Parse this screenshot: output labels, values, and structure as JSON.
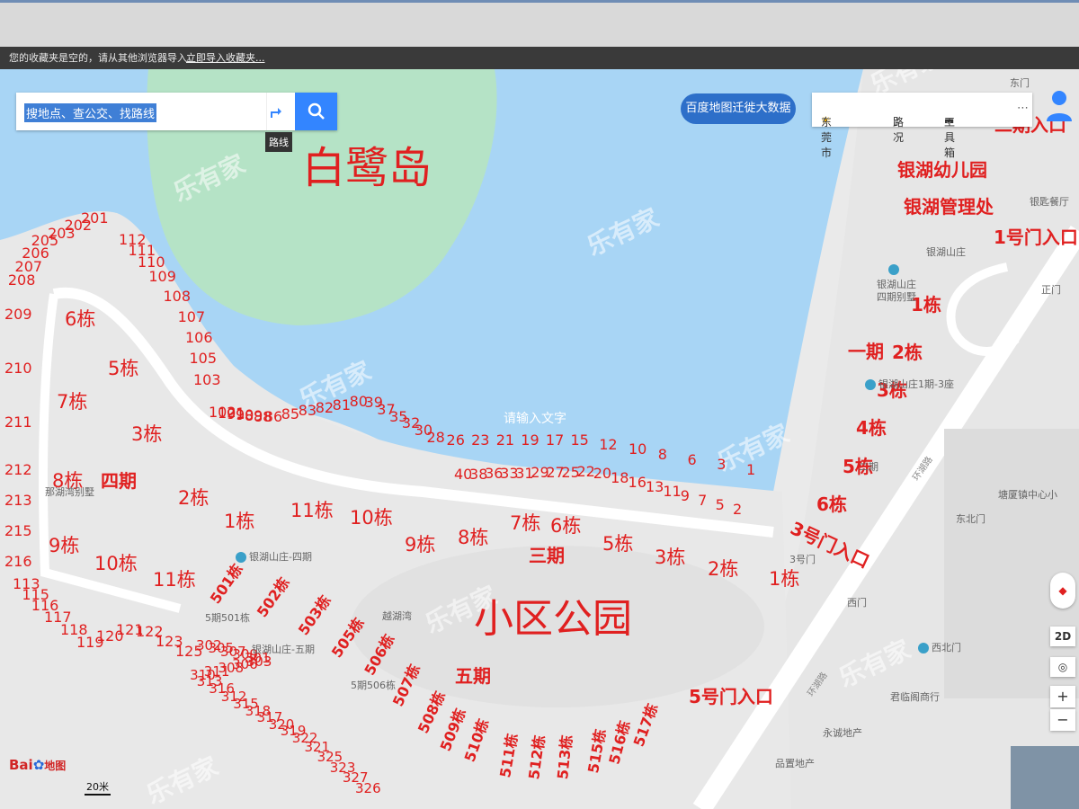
{
  "favorites_bar": {
    "message": "您的收藏夹是空的，请从其他浏览器导入。",
    "import_link": "立即导入收藏夹..."
  },
  "search": {
    "placeholder": "搜地点、查公交、找路线",
    "route_tooltip": "路线"
  },
  "top_right": {
    "migration_button": "百度地图迁徙大数据",
    "city": "东莞市",
    "traffic": "路况",
    "toolbox": "工具箱"
  },
  "map_controls": {
    "mode_2d": "2D",
    "zoom_in": "+",
    "zoom_out": "−"
  },
  "logo": {
    "bai": "Bai",
    "du": "du",
    "ditu": "地图"
  },
  "scale": {
    "label": "20米"
  },
  "watermark": {
    "text": "乐有家"
  },
  "map_text": {
    "egret_island": "白鹭岛",
    "park": "小区公园",
    "phase1": "一期",
    "phase3": "三期",
    "phase4": "四期",
    "phase5": "五期",
    "phase2_entrance": "二期入口",
    "kindergarten": "银湖幼儿园",
    "management": "银湖管理处",
    "gate1": "1号门入口",
    "gate3": "3号门入口",
    "gate5": "5号门入口",
    "input_text": "请输入文字"
  },
  "pois": {
    "villa4": [
      "银湖山庄",
      "四期别墅"
    ],
    "phase1_3": "银湖山庄1期-3座",
    "yinhu_shanzhuang": "银湖山庄",
    "yinhu_4": "银湖山庄-四期",
    "yinhu_5": "银湖山庄-五期",
    "yuehuwan": "越湖湾",
    "naji_villa": "那湖湾别墅",
    "restaurant": "银匙餐厅",
    "east_gate": "东门",
    "main_gate": "正门",
    "west_gate": "西门",
    "northwest_gate": "西北门",
    "northeast_gate": "东北门",
    "gate3_poi": "3号门",
    "tangxia_center": "塘厦镇中心小",
    "junlinge": "君临阁商行",
    "yongcheng": "永诚地产",
    "pinzhi": "品置地产",
    "r2": "二期",
    "b5_501": "5期501栋",
    "b5_506": "5期506栋",
    "road1": "环湖路",
    "road2": "环湖路"
  },
  "buildings": {
    "p4": [
      "6栋",
      "5栋",
      "7栋",
      "3栋",
      "8栋",
      "2栋",
      "1栋",
      "9栋",
      "10栋",
      "11栋"
    ],
    "p3": [
      "11栋",
      "10栋",
      "9栋",
      "8栋",
      "7栋",
      "6栋",
      "5栋",
      "3栋",
      "2栋",
      "1栋"
    ],
    "p1": [
      "1栋",
      "2栋",
      "3栋",
      "4栋",
      "5栋",
      "6栋"
    ],
    "p5": [
      "501栋",
      "502栋",
      "503栋",
      "505栋",
      "506栋",
      "507栋",
      "508栋",
      "509栋",
      "510栋",
      "511栋",
      "512栋",
      "513栋",
      "515栋",
      "516栋",
      "517栋"
    ]
  },
  "villa_numbers": {
    "top_lake": [
      "102",
      "101",
      "91",
      "90",
      "89",
      "88",
      "86",
      "85",
      "83",
      "82",
      "81",
      "80",
      "39",
      "37",
      "35",
      "32",
      "30",
      "28",
      "26",
      "23",
      "21",
      "19",
      "17",
      "15",
      "12",
      "10",
      "8",
      "6",
      "3",
      "1"
    ],
    "lower_lake": [
      "40",
      "38",
      "36",
      "33",
      "31",
      "29",
      "27",
      "25",
      "22",
      "20",
      "18",
      "16",
      "13",
      "11",
      "9",
      "7",
      "5",
      "2"
    ],
    "west_top": [
      "201",
      "202",
      "203",
      "205",
      "206",
      "207",
      "208",
      "209",
      "210",
      "211",
      "212",
      "213",
      "215",
      "216"
    ],
    "west_col": [
      "112",
      "111",
      "110",
      "109",
      "108",
      "107",
      "106",
      "105",
      "103"
    ],
    "south_west": [
      "113",
      "115",
      "116",
      "117",
      "118",
      "119",
      "120",
      "121",
      "122",
      "123",
      "125"
    ],
    "south_300": [
      "302",
      "305",
      "307",
      "309",
      "301",
      "303",
      "306",
      "308",
      "311",
      "310",
      "313",
      "316",
      "312",
      "315",
      "318",
      "317",
      "320",
      "319",
      "322",
      "321",
      "325",
      "323",
      "327",
      "326"
    ]
  }
}
